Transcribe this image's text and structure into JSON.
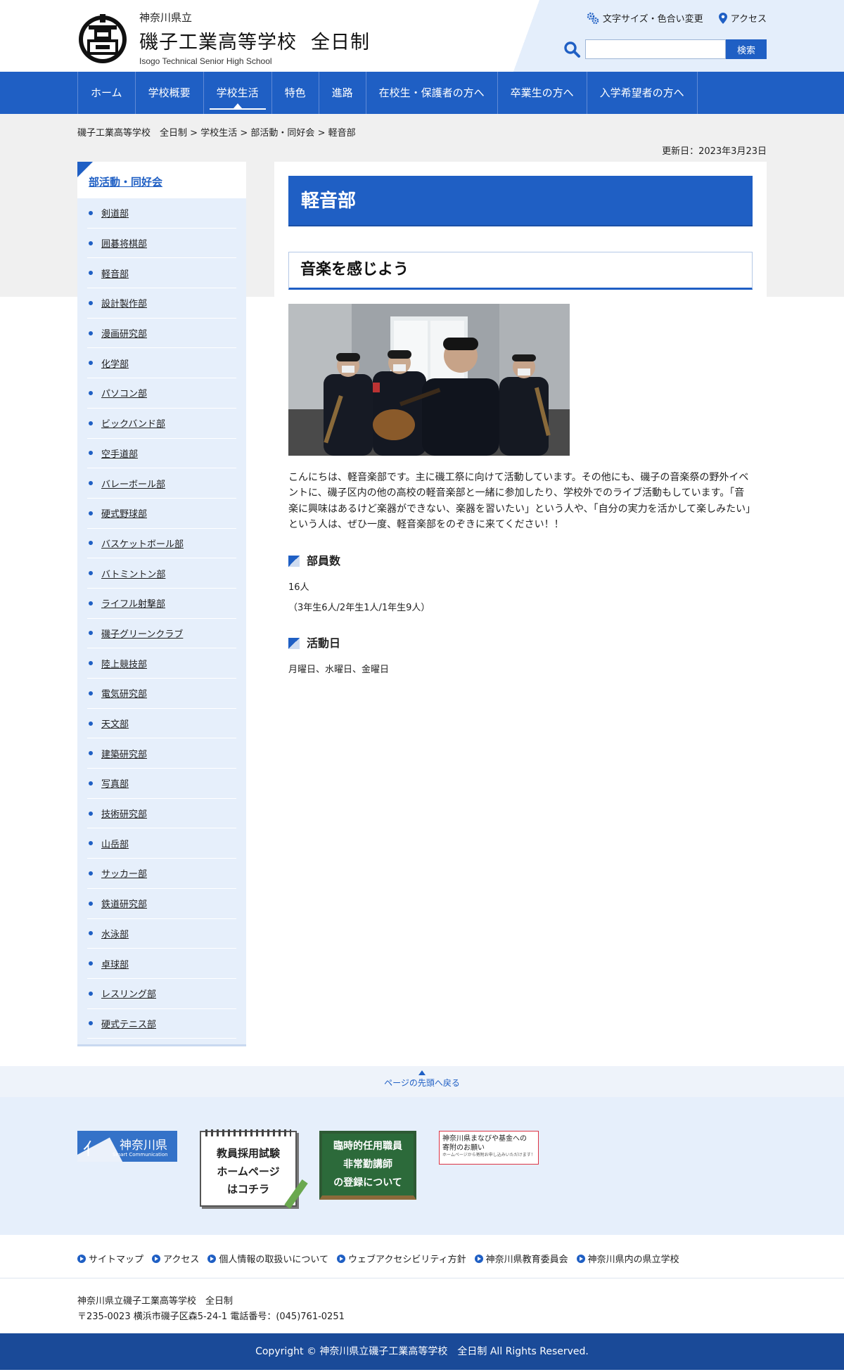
{
  "header": {
    "pref": "神奈川県立",
    "school_name": "磯子工業高等学校",
    "course": "全日制",
    "school_en": "Isogo Technical Senior High School",
    "util_font": "文字サイズ・色合い変更",
    "util_access": "アクセス",
    "search_button": "検索",
    "search_placeholder": ""
  },
  "gnav": [
    {
      "label": "ホーム"
    },
    {
      "label": "学校概要"
    },
    {
      "label": "学校生活"
    },
    {
      "label": "特色"
    },
    {
      "label": "進路"
    },
    {
      "label": "在校生・保護者の方へ"
    },
    {
      "label": "卒業生の方へ"
    },
    {
      "label": "入学希望者の方へ"
    }
  ],
  "breadcrumb": {
    "item1": "磯子工業高等学校　全日制",
    "item2": "学校生活",
    "item3": "部活動・同好会",
    "item4": "軽音部",
    "sep": ">"
  },
  "updated": "更新日：2023年3月23日",
  "sidebar": {
    "title": "部活動・同好会",
    "items": [
      "剣道部",
      "囲碁将棋部",
      "軽音部",
      "設計製作部",
      "漫画研究部",
      "化学部",
      "パソコン部",
      "ビックバンド部",
      "空手道部",
      "バレーボール部",
      "硬式野球部",
      "バスケットボール部",
      "バトミントン部",
      "ライフル射撃部",
      "磯子グリーンクラブ",
      "陸上競技部",
      "電気研究部",
      "天文部",
      "建築研究部",
      "写真部",
      "技術研究部",
      "山岳部",
      "サッカー部",
      "鉄道研究部",
      "水泳部",
      "卓球部",
      "レスリング部",
      "硬式テニス部"
    ]
  },
  "main": {
    "title": "軽音部",
    "subtitle": "音楽を感じよう",
    "intro": "こんにちは、軽音楽部です。主に磯工祭に向けて活動しています。その他にも、磯子の音楽祭の野外イベントに、磯子区内の他の高校の軽音楽部と一緒に参加したり、学校外でのライブ活動もしています。「音楽に興味はあるけど楽器ができない、楽器を習いたい」という人や、「自分の実力を活かして楽しみたい」という人は、ぜひ一度、軽音楽部をのぞきに来てください！！",
    "members_heading": "部員数",
    "members_count": "16人",
    "members_breakdown": "（3年生6人/2年生1人/1年生9人）",
    "days_heading": "活動日",
    "days": "月曜日、水曜日、金曜日"
  },
  "pagetop": "ページの先頭へ戻る",
  "banners": {
    "kanagawa_main": "神奈川県",
    "kanagawa_sub": "Smart Communication",
    "teacher_line1": "教員採用試験",
    "teacher_line2": "ホームページ",
    "teacher_line3": "はコチラ",
    "board_line1": "臨時的任用職員",
    "board_line2": "非常勤講師",
    "board_line3": "の登録について",
    "fund_line1": "神奈川県まなびや基金への",
    "fund_line2": "寄附のお願い",
    "fund_small": "ホームページから寄附お申し込みいただけます！"
  },
  "footer": {
    "links": [
      "サイトマップ",
      "アクセス",
      "個人情報の取扱いについて",
      "ウェブアクセシビリティ方針",
      "神奈川県教育委員会",
      "神奈川県内の県立学校"
    ],
    "address_name": "神奈川県立磯子工業高等学校　全日制",
    "address_line": "〒235-0023 横浜市磯子区森5-24-1 電話番号：(045)761-0251",
    "copyright": "Copyright © 神奈川県立磯子工業高等学校　全日制 All Rights Reserved."
  },
  "colors": {
    "accent": "#1f5fc4",
    "nav_bg": "#1f5fc4",
    "sidebar_bg": "#e6effb",
    "footer_bg": "#1a4a98"
  }
}
